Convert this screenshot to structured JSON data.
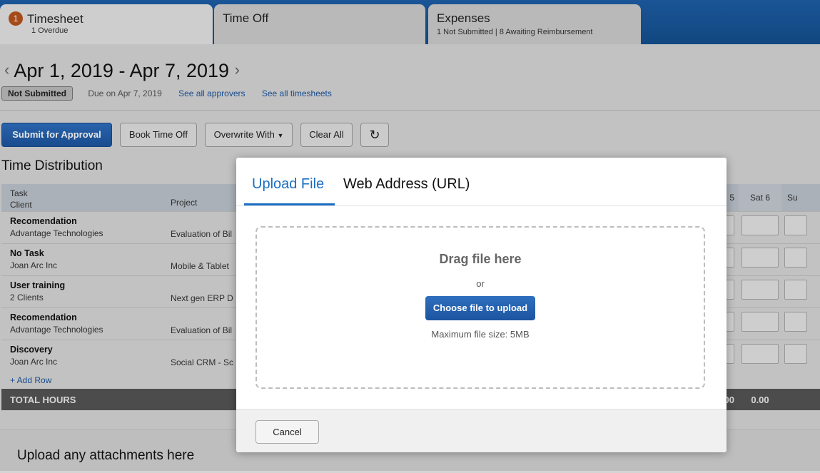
{
  "tabs": [
    {
      "badge": "1",
      "title": "Timesheet",
      "subtitle": "1 Overdue"
    },
    {
      "title": "Time Off",
      "subtitle": ""
    },
    {
      "title": "Expenses",
      "subtitle": "1 Not Submitted | 8 Awaiting Reimbursement"
    }
  ],
  "period": {
    "prev": "‹",
    "label": "Apr 1, 2019 - Apr 7, 2019",
    "next": "›"
  },
  "status": {
    "badge": "Not Submitted",
    "due": "Due on Apr 7, 2019",
    "link_approvers": "See all approvers",
    "link_timesheets": "See all timesheets"
  },
  "toolbar": {
    "submit": "Submit for Approval",
    "book_time_off": "Book Time Off",
    "overwrite": "Overwrite With",
    "clear_all": "Clear All",
    "refresh_icon": "refresh-icon"
  },
  "section": {
    "time_distribution": "Time Distribution"
  },
  "grid": {
    "head_task": "Task",
    "head_client": "Client",
    "head_project": "Project",
    "head_fri_partial": "5",
    "head_sat": "Sat 6",
    "head_sun_partial": "Su",
    "rows": [
      {
        "task": "Recomendation",
        "client": "Advantage Technologies",
        "project": "Evaluation of Bil"
      },
      {
        "task": "No Task",
        "client": "Joan Arc Inc",
        "project": "Mobile & Tablet"
      },
      {
        "task": "User training",
        "client": "2 Clients",
        "project": "Next gen ERP D"
      },
      {
        "task": "Recomendation",
        "client": "Advantage Technologies",
        "project": "Evaluation of Bil"
      },
      {
        "task": "Discovery",
        "client": "Joan Arc Inc",
        "project": "Social CRM - Sc"
      }
    ],
    "add_row": "+ Add Row",
    "total_label": "TOTAL HOURS",
    "total_fri_partial": ".00",
    "total_sat": "0.00"
  },
  "attachments": {
    "title": "Upload any attachments here"
  },
  "modal": {
    "tab_upload": "Upload File",
    "tab_url": "Web Address (URL)",
    "drag_text": "Drag file here",
    "or_text": "or",
    "choose_button": "Choose file to upload",
    "max_size": "Maximum file size: 5MB",
    "cancel": "Cancel"
  },
  "colors": {
    "brand": "#1b6ec2",
    "topbar": "#1e5fa8",
    "overdue_badge": "#b8531c"
  }
}
